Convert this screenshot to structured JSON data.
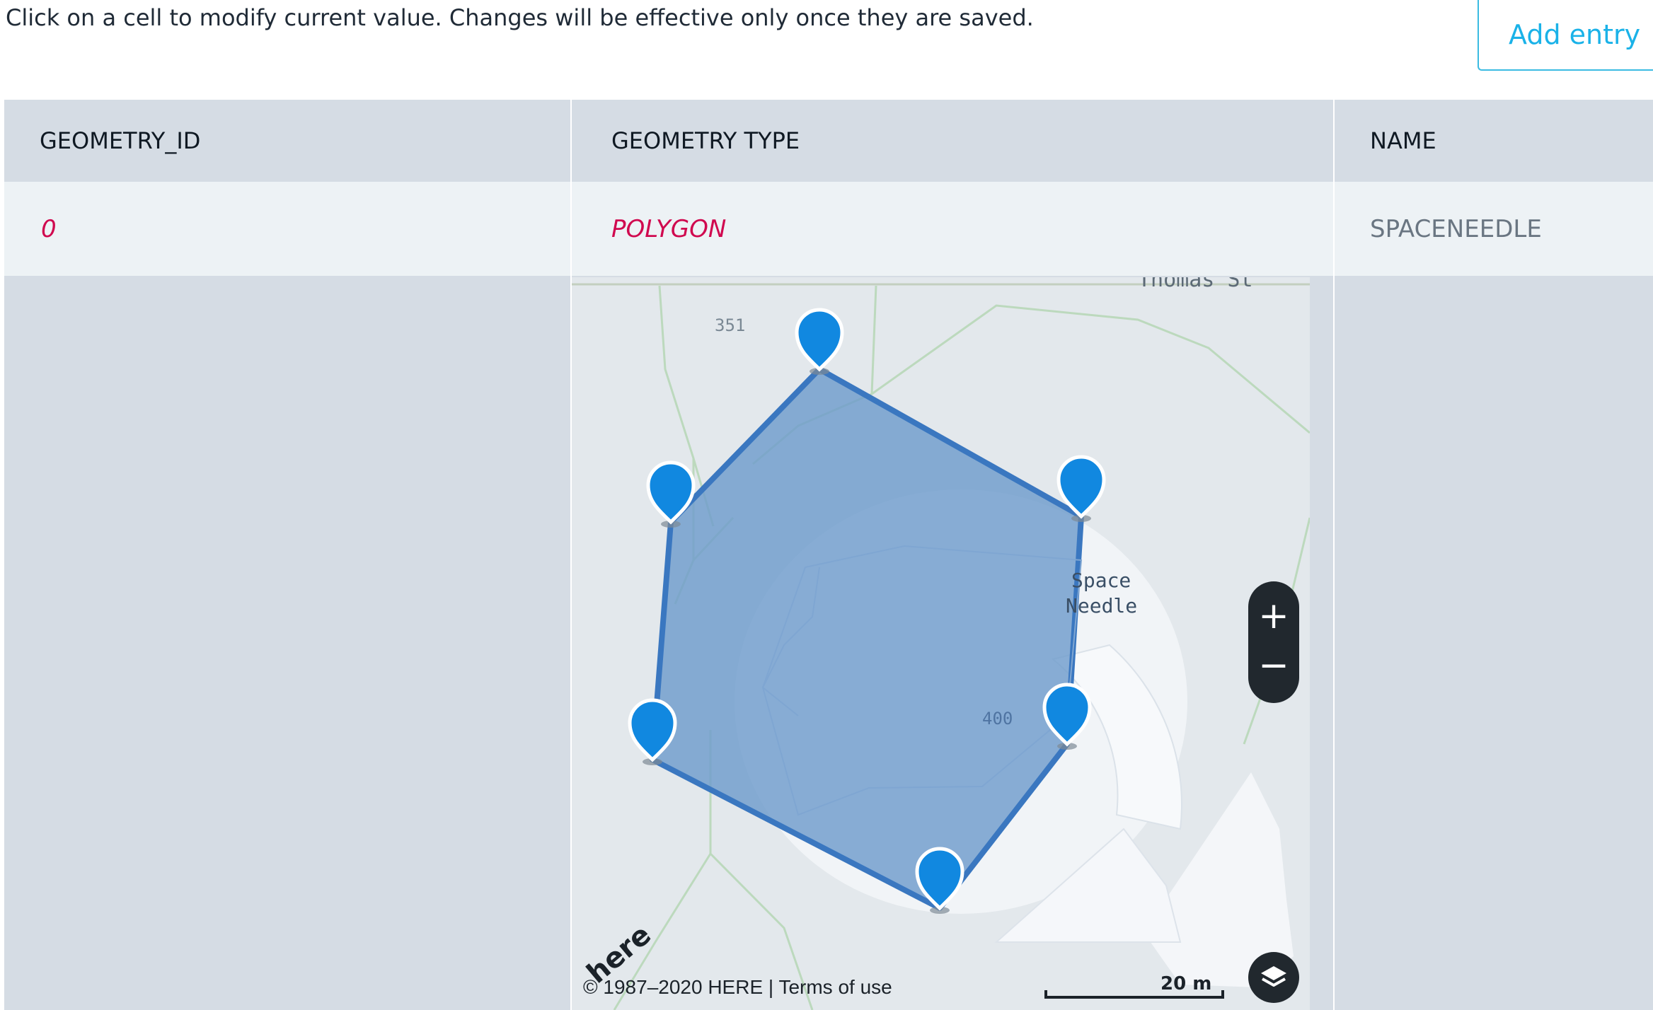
{
  "instructions": "Click on a cell to modify current value. Changes will be effective only once they are saved.",
  "add_entry_label": "Add entry",
  "table": {
    "headers": [
      "GEOMETRY_ID",
      "GEOMETRY TYPE",
      "NAME"
    ],
    "row": {
      "geometry_id": "0",
      "geometry_type": "POLYGON",
      "name": "SPACENEEDLE"
    }
  },
  "map": {
    "street_label": "Thomas St",
    "block_label_1": "351",
    "block_label_2": "400",
    "poi_label_1": "Space",
    "poi_label_2": "Needle",
    "zoom_in": "+",
    "zoom_out": "−",
    "copyright": "© 1987–2020 HERE | Terms of use",
    "brand": "here",
    "scale": "20 m",
    "polygon_vertex_count": 6,
    "colors": {
      "polygon_fill": "#6f9ccc",
      "polygon_stroke": "#3a77c0",
      "marker": "#1188e0",
      "map_bg": "#e3e8ec",
      "control_bg": "#21282e"
    }
  }
}
